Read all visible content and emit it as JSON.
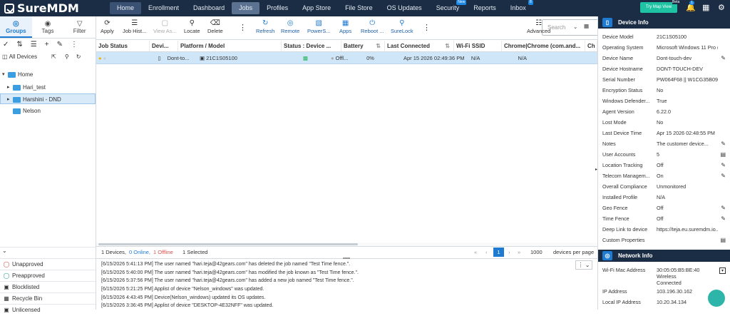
{
  "app": {
    "name": "SureMDM"
  },
  "nav": [
    {
      "label": "Home",
      "state": "active"
    },
    {
      "label": "Enrollment"
    },
    {
      "label": "Dashboard"
    },
    {
      "label": "Jobs",
      "state": "hover"
    },
    {
      "label": "Profiles"
    },
    {
      "label": "App Store"
    },
    {
      "label": "File Store"
    },
    {
      "label": "OS Updates"
    },
    {
      "label": "Security",
      "badge": "New"
    },
    {
      "label": "Reports"
    },
    {
      "label": "Inbox",
      "badge": "8"
    }
  ],
  "topright": {
    "try_map": "Try Map View",
    "beta": "Beta",
    "notif_count": "1"
  },
  "left_tabs": [
    {
      "label": "Groups"
    },
    {
      "label": "Tags"
    },
    {
      "label": "Filter"
    }
  ],
  "all_devices": "All Devices",
  "tree": [
    {
      "label": "Home"
    },
    {
      "label": "Hari_test"
    },
    {
      "label": "Harshini - DND"
    },
    {
      "label": "Nelson"
    }
  ],
  "bottom_list": [
    {
      "label": "Unapproved"
    },
    {
      "label": "Preapproved"
    },
    {
      "label": "Blocklisted"
    },
    {
      "label": "Recycle Bin"
    },
    {
      "label": "Unlicensed"
    }
  ],
  "toolbar": {
    "apply": "Apply",
    "job_history": "Job Hist...",
    "view_as": "View As...",
    "locate": "Locate",
    "delete": "Delete",
    "refresh": "Refresh",
    "remote": "Remote",
    "powershell": "PowerS...",
    "apps": "Apps",
    "reboot": "Reboot ...",
    "surelock": "SureLock",
    "search_placeholder": "Search",
    "advanced": "Advanced"
  },
  "grid": {
    "headers": [
      "Job Status",
      "Devi...",
      "Platform / Model",
      "Status : Device ...",
      "Battery",
      "Last Connected",
      "Wi-Fi SSID",
      "Chrome|Chrome (com.and...",
      "Ch"
    ],
    "row": {
      "model": "Dont-to...",
      "platform_model": "21C1S05100",
      "status": "Offl...",
      "battery": "0%",
      "last_connected": "Apr 15 2026 02:49:36 PM",
      "wifi": "N/A",
      "chrome": "N/A"
    }
  },
  "footer": {
    "devices": "1 Devices,",
    "online": "0 Online,",
    "offline": "1 Offline",
    "selected": "1 Selected",
    "page": "1",
    "per_page_value": "1000",
    "per_page_label": "devices per page"
  },
  "logs": [
    "[6/15/2026 5:41:13 PM] The user named \"hari.teja@42gears.com\" has deleted the job named \"Test Time fence.\".",
    "[6/15/2026 5:40:00 PM] The user named \"hari.teja@42gears.com\" has modified the job known as \"Test Time fence.\".",
    "[6/15/2026 5:37:56 PM] The user named \"hari.teja@42gears.com\" has added a new job named \"Test Time fence.\".",
    "[6/15/2026 5:21:25 PM] Applist of device \"Nelson_windows\" was updated.",
    "[6/15/2026 4:43:45 PM] Device(Nelson_windows) updated its OS updates.",
    "[6/15/2026 3:36:45 PM] Applist of device \"DESKTOP-4E32NFF\" was updated."
  ],
  "device_info": {
    "title": "Device Info",
    "props": [
      {
        "k": "Device Model",
        "v": "21C1S05100"
      },
      {
        "k": "Operating System",
        "v": "Microsoft Windows 11 Pro (..."
      },
      {
        "k": "Device Name",
        "v": "Dont-touch-dev",
        "edit": true
      },
      {
        "k": "Device Hostname",
        "v": "DONT-TOUCH-DEV"
      },
      {
        "k": "Serial Number",
        "v": "PW064F68 || W1CG35B09KZ"
      },
      {
        "k": "Encryption Status",
        "v": "No"
      },
      {
        "k": "Windows Defender...",
        "v": "True"
      },
      {
        "k": "Agent Version",
        "v": "6.22.0"
      },
      {
        "k": "Lost Mode",
        "v": "No"
      },
      {
        "k": "Last Device Time",
        "v": "Apr 15 2026 02:48:55 PM"
      },
      {
        "k": "Notes",
        "v": "The customer device...",
        "edit": true
      },
      {
        "k": "User Accounts",
        "v": "5",
        "edit": true
      },
      {
        "k": "Location Tracking",
        "v": "Off",
        "edit": true
      },
      {
        "k": "Telecom Managem...",
        "v": "On",
        "edit": true
      },
      {
        "k": "Overall Compliance",
        "v": "Unmonitored"
      },
      {
        "k": "Installed Profile",
        "v": "N/A"
      },
      {
        "k": "Geo Fence",
        "v": "Off",
        "edit": true
      },
      {
        "k": "Time Fence",
        "v": "Off",
        "edit": true
      },
      {
        "k": "Deep Link to device",
        "v": "https://teja.eu.suremdm.io..."
      },
      {
        "k": "Custom Properties",
        "v": "",
        "edit": true
      }
    ]
  },
  "network_info": {
    "title": "Network Info",
    "props": [
      {
        "k": "Wi-Fi Mac Address",
        "v": "30:05:05:B5:BE:40",
        "v2": "Wireless",
        "v3": "Connected"
      },
      {
        "k": "IP Address",
        "v": "103.196.30.162"
      },
      {
        "k": "Local IP Address",
        "v": "10.20.34.134"
      }
    ]
  }
}
